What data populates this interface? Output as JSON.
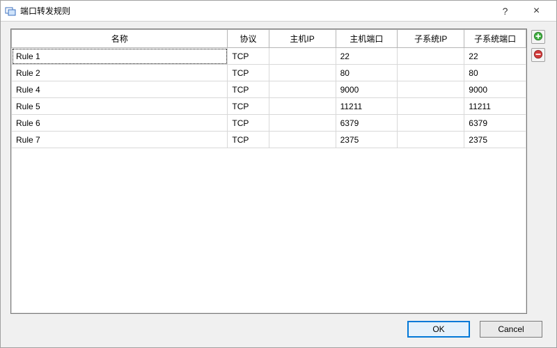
{
  "window": {
    "title": "端口转发规则",
    "help_label": "?",
    "close_label": "×"
  },
  "table": {
    "headers": {
      "name": "名称",
      "protocol": "协议",
      "host_ip": "主机IP",
      "host_port": "主机端口",
      "sub_ip": "子系统IP",
      "sub_port": "子系统端口"
    },
    "rows": [
      {
        "name": "Rule 1",
        "protocol": "TCP",
        "host_ip": "",
        "host_port": "22",
        "sub_ip": "",
        "sub_port": "22",
        "selected": true
      },
      {
        "name": "Rule 2",
        "protocol": "TCP",
        "host_ip": "",
        "host_port": "80",
        "sub_ip": "",
        "sub_port": "80",
        "selected": false
      },
      {
        "name": "Rule 4",
        "protocol": "TCP",
        "host_ip": "",
        "host_port": "9000",
        "sub_ip": "",
        "sub_port": "9000",
        "selected": false
      },
      {
        "name": "Rule 5",
        "protocol": "TCP",
        "host_ip": "",
        "host_port": "11211",
        "sub_ip": "",
        "sub_port": "11211",
        "selected": false
      },
      {
        "name": "Rule 6",
        "protocol": "TCP",
        "host_ip": "",
        "host_port": "6379",
        "sub_ip": "",
        "sub_port": "6379",
        "selected": false
      },
      {
        "name": "Rule 7",
        "protocol": "TCP",
        "host_ip": "",
        "host_port": "2375",
        "sub_ip": "",
        "sub_port": "2375",
        "selected": false
      }
    ]
  },
  "side": {
    "add_name": "add-rule-icon",
    "remove_name": "remove-rule-icon"
  },
  "footer": {
    "ok_label": "OK",
    "cancel_label": "Cancel"
  },
  "colors": {
    "accent": "#0078d7",
    "add_green": "#3fae3f",
    "remove_red": "#d23b3b"
  }
}
